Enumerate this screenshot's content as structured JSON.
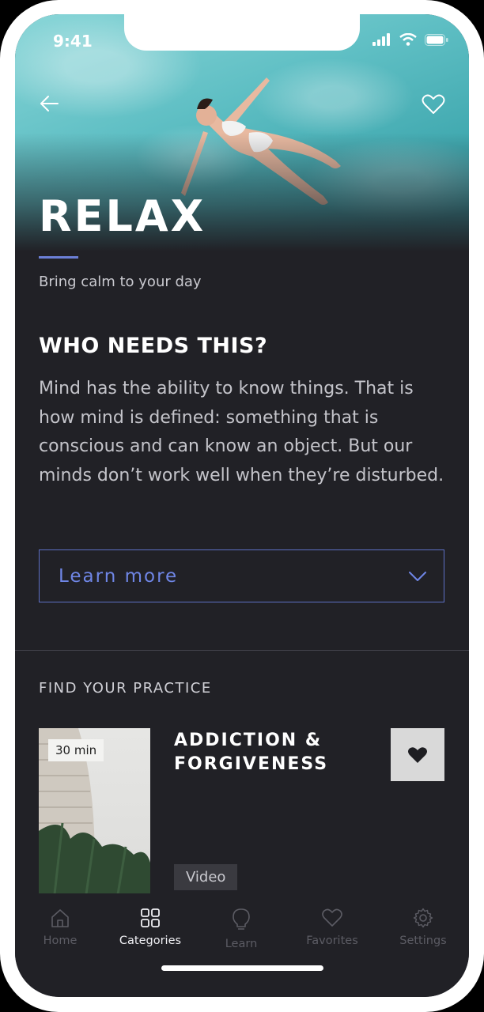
{
  "status_bar": {
    "time": "9:41"
  },
  "hero": {
    "title": "RELAX",
    "subtitle": "Bring calm to your day"
  },
  "about": {
    "heading": "WHO NEEDS THIS?",
    "body": "Mind has the ability to know things. That is how mind is defined: something that is conscious and can know an object. But our minds don’t work well when they’re disturbed.",
    "learn_more_label": "Learn more"
  },
  "practice": {
    "section_label": "FIND YOUR PRACTICE",
    "card": {
      "duration": "30 min",
      "title": "ADDICTION & FORGIVENESS",
      "type": "Video"
    }
  },
  "tabs": [
    {
      "label": "Home",
      "icon": "home-icon"
    },
    {
      "label": "Categories",
      "icon": "grid-icon"
    },
    {
      "label": "Learn",
      "icon": "lightbulb-icon"
    },
    {
      "label": "Favorites",
      "icon": "heart-icon"
    },
    {
      "label": "Settings",
      "icon": "gear-icon"
    }
  ],
  "active_tab": "Categories",
  "colors": {
    "background": "#212126",
    "accent": "#6f86e6",
    "text_primary": "#ffffff",
    "text_secondary": "#c4c4ca",
    "tab_inactive": "#5c5c64"
  }
}
